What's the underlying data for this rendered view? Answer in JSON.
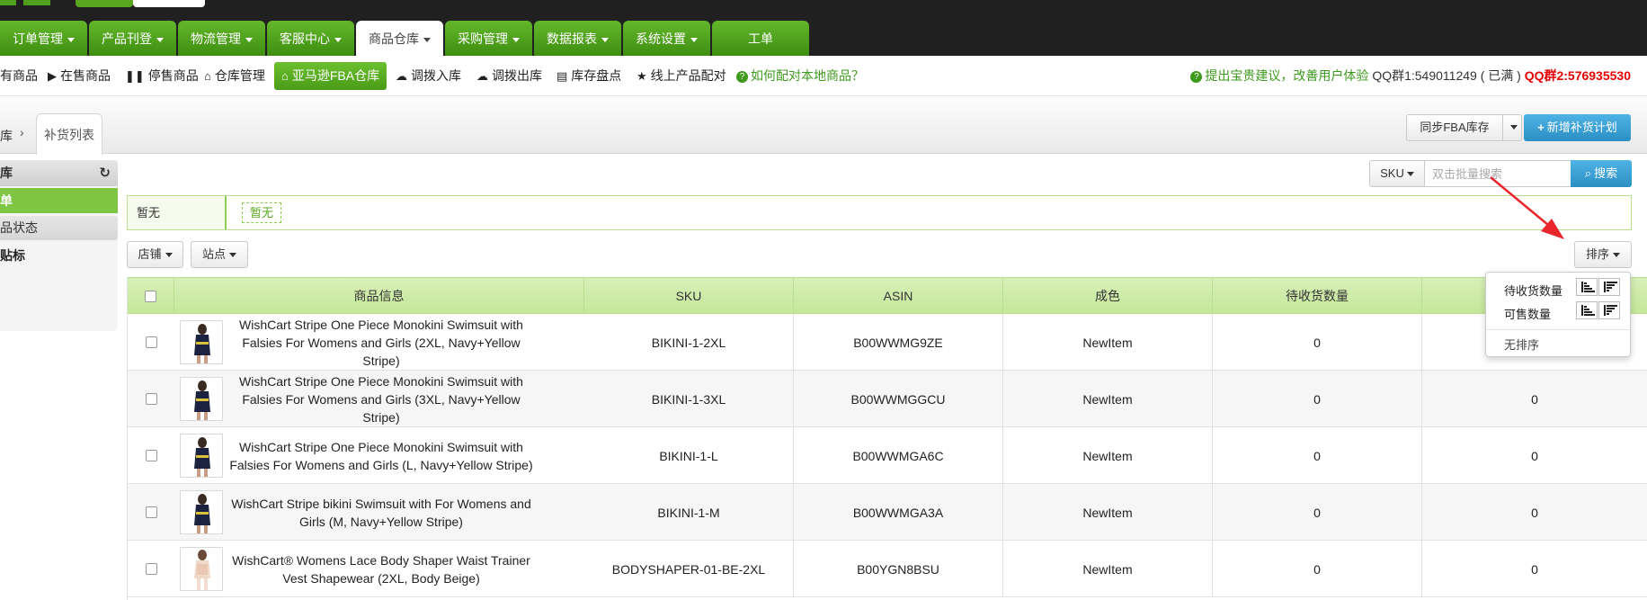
{
  "nav": {
    "tabs": [
      {
        "label": "订单管理",
        "caret": true
      },
      {
        "label": "产品刊登",
        "caret": true
      },
      {
        "label": "物流管理",
        "caret": true
      },
      {
        "label": "客服中心",
        "caret": true
      },
      {
        "label": "商品仓库",
        "caret": true,
        "active": true
      },
      {
        "label": "采购管理",
        "caret": true
      },
      {
        "label": "数据报表",
        "caret": true
      },
      {
        "label": "系统设置",
        "caret": true
      },
      {
        "label": "工单",
        "caret": false
      }
    ]
  },
  "subnav": {
    "items": [
      "有商品",
      "在售商品",
      "停售商品",
      "仓库管理",
      "亚马逊FBA仓库",
      "调拨入库",
      "调拨出库",
      "库存盘点",
      "线上产品配对"
    ],
    "help": "如何配对本地商品？",
    "suggest": "提出宝贵建议，改善用户体验",
    "qq1": "QQ群1:549011249 ( 已满 )",
    "qq2": "QQ群2:576935530"
  },
  "breadcrumb": {
    "prev": "库",
    "sep": "›",
    "current": "补货列表"
  },
  "toolbar": {
    "sync": "同步FBA库存",
    "new_plan": "新增补货计划"
  },
  "sidebar": {
    "title": "库",
    "active": "单",
    "sub": "品状态",
    "item": "贴标"
  },
  "search": {
    "field": "SKU",
    "placeholder": "双击批量搜索",
    "button": "搜索"
  },
  "filter": {
    "label": "暂无",
    "tag": "暂无"
  },
  "buttons": {
    "store": "店铺",
    "site": "站点",
    "sort": "排序"
  },
  "sort_menu": {
    "items": [
      "待收货数量",
      "可售数量"
    ],
    "none": "无排序"
  },
  "table": {
    "headers": [
      "商品信息",
      "SKU",
      "ASIN",
      "成色",
      "待收货数量",
      ""
    ],
    "rows": [
      {
        "title": "WishCart Stripe One Piece Monokini Swimsuit with Falsies For Womens and Girls (2XL, Navy+Yellow Stripe)",
        "sku": "BIKINI-1-2XL",
        "asin": "B00WWMG9ZE",
        "condition": "NewItem",
        "pending": "0",
        "sellable": ""
      },
      {
        "title": "WishCart Stripe One Piece Monokini Swimsuit with Falsies For Womens and Girls (3XL, Navy+Yellow Stripe)",
        "sku": "BIKINI-1-3XL",
        "asin": "B00WWMGGCU",
        "condition": "NewItem",
        "pending": "0",
        "sellable": "0"
      },
      {
        "title": "WishCart Stripe One Piece Monokini Swimsuit with Falsies For Womens and Girls (L, Navy+Yellow Stripe)",
        "sku": "BIKINI-1-L",
        "asin": "B00WWMGA6C",
        "condition": "NewItem",
        "pending": "0",
        "sellable": "0"
      },
      {
        "title": "WishCart Stripe bikini Swimsuit with For Womens and Girls (M, Navy+Yellow Stripe)",
        "sku": "BIKINI-1-M",
        "asin": "B00WWMGA3A",
        "condition": "NewItem",
        "pending": "0",
        "sellable": "0"
      },
      {
        "title": "WishCart® Womens Lace Body Shaper Waist Trainer Vest Shapewear (2XL, Body Beige)",
        "sku": "BODYSHAPER-01-BE-2XL",
        "asin": "B00YGN8BSU",
        "condition": "NewItem",
        "pending": "0",
        "sellable": "0"
      }
    ]
  },
  "colors": {
    "accent_green": "#4a9b18",
    "blue": "#2b8fc4",
    "red": "#e60000",
    "annotation_red": "#e8262b"
  },
  "icons": {
    "refresh": "refresh-icon",
    "search": "search-icon",
    "plus": "plus-icon",
    "home": "home-icon",
    "play": "play-icon",
    "pause": "pause-icon",
    "cloud_upload": "cloud-upload-icon",
    "cloud_download": "cloud-download-icon",
    "inventory": "inventory-icon",
    "star": "star-icon",
    "question": "question-icon",
    "sort_asc": "sort-ascending-icon",
    "sort_desc": "sort-descending-icon"
  }
}
